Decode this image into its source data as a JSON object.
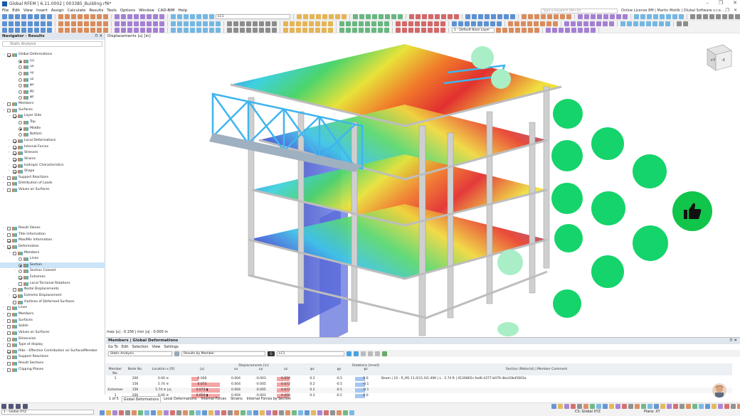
{
  "app": {
    "title": "Global RFEM | 6.11.0002 | 003385_Building.rf6*",
    "search_placeholder": "Type a keyword (Alt+Q)",
    "license": "Online License 8M | Martin Motlik | Dlubal Software s.r.o. ..."
  },
  "menu": [
    "File",
    "Edit",
    "View",
    "Insert",
    "Assign",
    "Calculate",
    "Results",
    "Tools",
    "Options",
    "Window",
    "CAD-BIM",
    "Help"
  ],
  "toolbar": {
    "load_case": "LC1",
    "load_case_tag": "G",
    "layer": "1 - Default Base Layer"
  },
  "navigator": {
    "title": "Navigator - Results",
    "analysis": "Static Analysis",
    "items": [
      {
        "l": "Global Deformations",
        "d": 0,
        "t": "chk",
        "on": true,
        "ex": "v"
      },
      {
        "l": "|u|",
        "d": 2,
        "t": "rad",
        "on": true
      },
      {
        "l": "ux",
        "d": 2,
        "t": "rad"
      },
      {
        "l": "uy",
        "d": 2,
        "t": "rad"
      },
      {
        "l": "uz",
        "d": 2,
        "t": "rad"
      },
      {
        "l": "φx",
        "d": 2,
        "t": "rad"
      },
      {
        "l": "φy",
        "d": 2,
        "t": "rad"
      },
      {
        "l": "φz",
        "d": 2,
        "t": "rad"
      },
      {
        "l": "Members",
        "d": 0,
        "t": "chk",
        "ex": ">"
      },
      {
        "l": "Surfaces",
        "d": 0,
        "t": "chk",
        "ex": "v"
      },
      {
        "l": "Layer Side",
        "d": 1,
        "t": "chk",
        "on": true,
        "ex": "v"
      },
      {
        "l": "Top",
        "d": 2,
        "t": "rad"
      },
      {
        "l": "Middle",
        "d": 2,
        "t": "rad",
        "on": true
      },
      {
        "l": "Bottom",
        "d": 2,
        "t": "rad"
      },
      {
        "l": "Local Deformations",
        "d": 1,
        "t": "chk",
        "on": true,
        "ex": ">"
      },
      {
        "l": "Internal Forces",
        "d": 1,
        "t": "chk",
        "on": true,
        "ex": ">"
      },
      {
        "l": "Stresses",
        "d": 1,
        "t": "chk",
        "on": true,
        "ex": ">"
      },
      {
        "l": "Strains",
        "d": 1,
        "t": "chk",
        "on": true,
        "ex": ">"
      },
      {
        "l": "Isotropic Characteristics",
        "d": 1,
        "t": "chk",
        "on": true,
        "ex": ">"
      },
      {
        "l": "Shape",
        "d": 1,
        "t": "chk",
        "on": true,
        "ex": ">"
      },
      {
        "l": "Support Reactions",
        "d": 0,
        "t": "chk",
        "ex": ">"
      },
      {
        "l": "Distribution of Loads",
        "d": 0,
        "t": "chk",
        "ex": ">"
      },
      {
        "l": "Values on Surfaces",
        "d": 0,
        "t": "chk",
        "ex": ">"
      }
    ],
    "display": [
      {
        "l": "Result Values",
        "d": 0,
        "t": "chk",
        "ex": ">"
      },
      {
        "l": "Title Information",
        "d": 0,
        "t": "chk",
        "ex": ">"
      },
      {
        "l": "Max/Min Information",
        "d": 0,
        "t": "chk",
        "on": true,
        "ex": ">"
      },
      {
        "l": "Deformation",
        "d": 0,
        "t": "chk",
        "on": true,
        "ex": "v"
      },
      {
        "l": "Members",
        "d": 1,
        "t": "chk",
        "ex": "v"
      },
      {
        "l": "Lines",
        "d": 2,
        "t": "rad"
      },
      {
        "l": "Section",
        "d": 2,
        "t": "rad",
        "on": true,
        "hl": true
      },
      {
        "l": "Section Colored",
        "d": 2,
        "t": "rad",
        "ex": ">"
      },
      {
        "l": "Extremes",
        "d": 2,
        "t": "chk",
        "on": true
      },
      {
        "l": "Local Torsional Rotations",
        "d": 2,
        "t": "chk"
      },
      {
        "l": "Nodal Displacements",
        "d": 1,
        "t": "chk",
        "ex": ">"
      },
      {
        "l": "Extreme Displacement",
        "d": 1,
        "t": "chk",
        "on": true,
        "ex": ">"
      },
      {
        "l": "Outlines of Deformed Surfaces",
        "d": 1,
        "t": "chk"
      },
      {
        "l": "Lines",
        "d": 0,
        "t": "chk",
        "ex": ">"
      },
      {
        "l": "Members",
        "d": 0,
        "t": "chk",
        "ex": ">"
      },
      {
        "l": "Surfaces",
        "d": 0,
        "t": "chk",
        "ex": ">"
      },
      {
        "l": "Solids",
        "d": 0,
        "t": "chk",
        "ex": ">"
      },
      {
        "l": "Values on Surfaces",
        "d": 0,
        "t": "chk",
        "ex": ">"
      },
      {
        "l": "Dimension",
        "d": 0,
        "t": "chk",
        "ex": ">"
      },
      {
        "l": "Type of display",
        "d": 0,
        "t": "chk",
        "ex": ">"
      },
      {
        "l": "Ribs - Effective Contribution on Surface/Member",
        "d": 0,
        "t": "chk",
        "on": true,
        "ex": ">"
      },
      {
        "l": "Support Reactions",
        "d": 0,
        "t": "chk",
        "ex": ">"
      },
      {
        "l": "Result Sections",
        "d": 0,
        "t": "chk",
        "ex": ">"
      },
      {
        "l": "Clipping Planes",
        "d": 0,
        "t": "chk",
        "ex": ">"
      }
    ]
  },
  "viewport": {
    "title": "Displacements |u| [in]",
    "legend": "max |u| : 0.156 | min |u| : 0.000 in",
    "cube_label": "+Y",
    "cube_label2": "-X"
  },
  "panel": {
    "title": "Members | Global Deformations",
    "menu": [
      "Go To",
      "Edit",
      "Selection",
      "View",
      "Settings"
    ],
    "analysis": "Static Analysis",
    "filter": "Results by Member",
    "lc": "LC1",
    "lc_tag": "G",
    "group_headers": [
      "Displacements [in]",
      "Rotations [mrad]"
    ],
    "headers": [
      "Member No.",
      "Node No.",
      "Location x [ft]",
      "|u|",
      "ux",
      "uy",
      "uz",
      "φx",
      "φy",
      "φz",
      "Section (Material) | Member Comment"
    ],
    "rows": [
      [
        "1",
        "200",
        "0.00 ≡",
        "0.000",
        "0.004",
        "-0.003",
        "0.050",
        "0.2",
        "-0.5",
        "0.0",
        "Beam | 10 - R_M1 11.0/11.0/1.496 | L : 5.74 ft | 0126865c-fad6-4377-b076-4ba10bd5603a"
      ],
      [
        "",
        "156",
        "5.74 ≡",
        "0.073",
        "0.004",
        "-0.005",
        "0.072",
        "0.2",
        "-0.5",
        "-0.1",
        ""
      ],
      [
        "Extremes",
        "156",
        "5.74 ≡ |u|",
        "0.073 ▮",
        "0.004",
        "-0.005",
        "0.072",
        "0.2",
        "-0.5",
        "-0.1",
        ""
      ],
      [
        "1",
        "200",
        "0.00 ≡",
        "0.050 ▮",
        "0.004",
        "-0.003",
        "0.050",
        "0.2",
        "-0.5",
        "0.0",
        ""
      ]
    ],
    "pager": "1 of 5",
    "tabs": [
      "Global Deformations",
      "Local Deformations",
      "Internal Forces",
      "Strains",
      "Internal Forces by Section"
    ]
  },
  "status": {
    "view": "1 - Global XYZ",
    "cs": "CS: Global XYZ",
    "plane": "Plane: XY"
  }
}
